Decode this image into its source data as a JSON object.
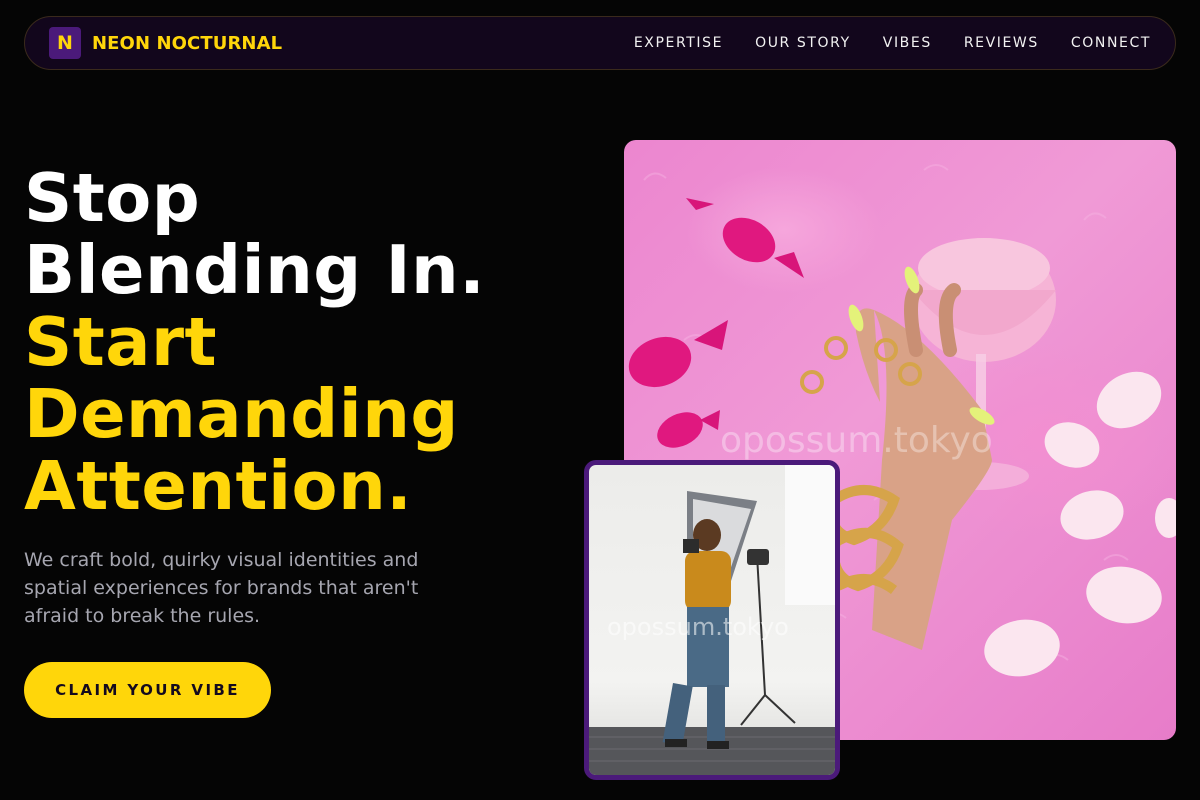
{
  "brand": {
    "mark": "N",
    "name": "NEON NOCTURNAL"
  },
  "nav": {
    "links": [
      "EXPERTISE",
      "OUR STORY",
      "VIBES",
      "REVIEWS",
      "CONNECT"
    ]
  },
  "hero": {
    "title_line_1": "Stop",
    "title_line_2": "Blending In.",
    "title_line_3": "Start",
    "title_line_4": "Demanding",
    "title_line_5": "Attention.",
    "subtitle": "We craft bold, quirky visual identities and spatial experiences for brands that aren't afraid to break the rules.",
    "cta_label": "CLAIM YOUR VIBE"
  },
  "images": {
    "main_watermark": "opossum.tokyo",
    "inset_watermark": "opossum.tokyo"
  },
  "colors": {
    "accent_yellow": "#ffd60a",
    "brand_purple": "#4b1a7a",
    "background": "#050505",
    "nav_background": "#12061c"
  }
}
